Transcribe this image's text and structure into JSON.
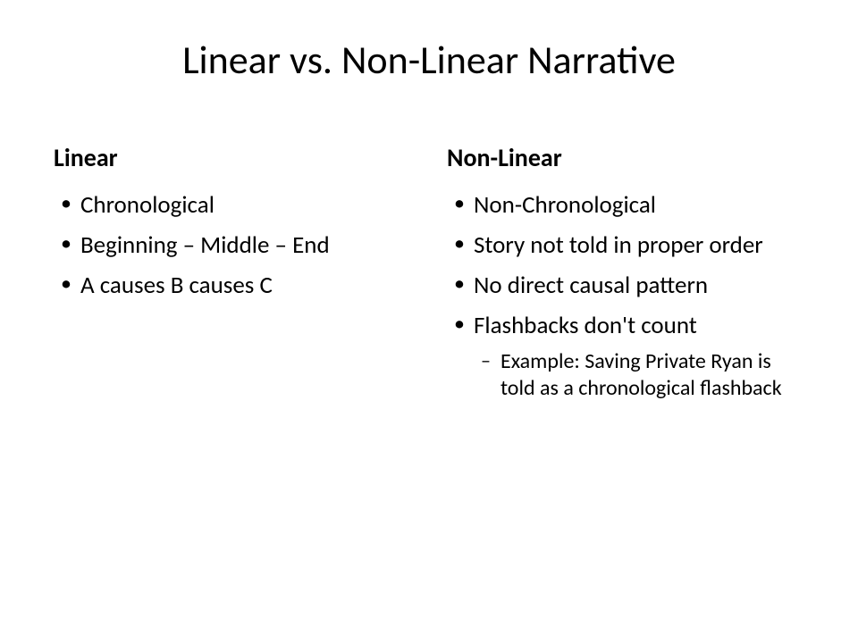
{
  "title": "Linear vs. Non-Linear Narrative",
  "left": {
    "heading": "Linear",
    "items": [
      "Chronological",
      "Beginning – Middle – End",
      "A causes B causes C"
    ]
  },
  "right": {
    "heading": "Non-Linear",
    "items": [
      "Non-Chronological",
      "Story not told in proper order",
      "No direct causal pattern",
      "Flashbacks don't count"
    ],
    "subitem": "Example: Saving Private Ryan is told as a chronological flashback"
  }
}
